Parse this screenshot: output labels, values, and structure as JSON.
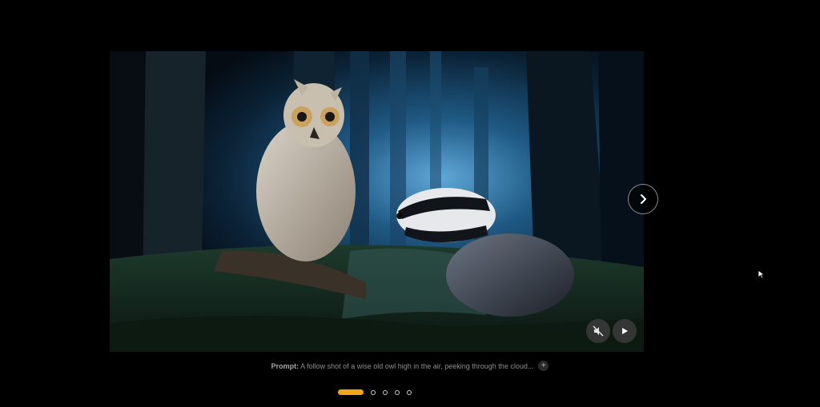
{
  "slide": {
    "image_alt": "An owl perched on a log beside a badger in a moonlit forest",
    "prompt_label": "Prompt:",
    "prompt_text": "A follow shot of a wise old owl high in the air, peeking through the cloud...",
    "expand_symbol": "+"
  },
  "icons": {
    "next": "chevron-right-icon",
    "mute": "volume-off-icon",
    "play": "play-icon",
    "cursor": "mouse-pointer-icon"
  },
  "pager": {
    "total": 5,
    "active_index": 0
  },
  "colors": {
    "background": "#000000",
    "pager_active": "#f2a516",
    "caption_text": "#8d8d8d"
  }
}
